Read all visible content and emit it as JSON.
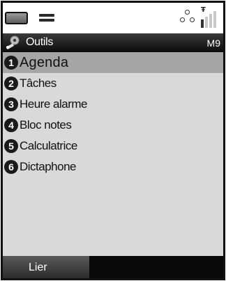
{
  "status": {
    "battery_icon": "battery-icon",
    "equalizer_icon": "equalizer-icon",
    "connection_icon": "connection-icon",
    "signal_icon": "signal-strength-icon"
  },
  "header": {
    "icon": "tools-icon",
    "title": "Outils",
    "mode": "M9"
  },
  "menu": {
    "items": [
      {
        "number": "1",
        "label": "Agenda"
      },
      {
        "number": "2",
        "label": "Tâches"
      },
      {
        "number": "3",
        "label": "Heure alarme"
      },
      {
        "number": "4",
        "label": "Bloc notes"
      },
      {
        "number": "5",
        "label": "Calculatrice"
      },
      {
        "number": "6",
        "label": "Dictaphone"
      }
    ],
    "selected_index": 0
  },
  "softkeys": {
    "left_label": "Lier"
  },
  "colors": {
    "selection": "#a5a5a5",
    "background": "#d9d9d9",
    "title_bar": "#111111",
    "number_badge": "#1a1a1a"
  }
}
